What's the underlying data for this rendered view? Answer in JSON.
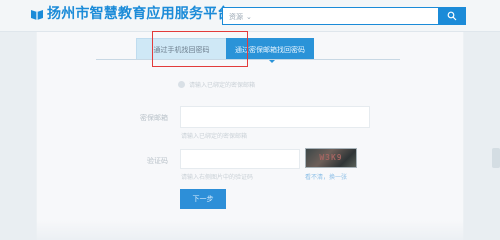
{
  "header": {
    "title": "扬州市智慧教育应用服务平台",
    "logo_icon": "book-logo-icon"
  },
  "search": {
    "scope_label": "资源",
    "input_value": "",
    "placeholder": "",
    "button_icon": "search-icon"
  },
  "tabs": [
    {
      "label": "通过手机找回密码",
      "state": "inactive"
    },
    {
      "label": "通过密保邮箱找回密码",
      "state": "active"
    }
  ],
  "tip": {
    "text": "请输入已绑定的密保邮箱"
  },
  "form": {
    "email_label": "密保邮箱",
    "email_value": "",
    "email_hint": "请输入已绑定的密保邮箱",
    "code_label": "验证码",
    "code_value": "",
    "code_hint": "请输入右侧图片中的验证码",
    "captcha_text": "W3K9",
    "refresh_label": "看不清，换一张",
    "next_label": "下一步"
  },
  "colors": {
    "brand": "#1b8bd8",
    "highlight": "#e23b3b"
  }
}
